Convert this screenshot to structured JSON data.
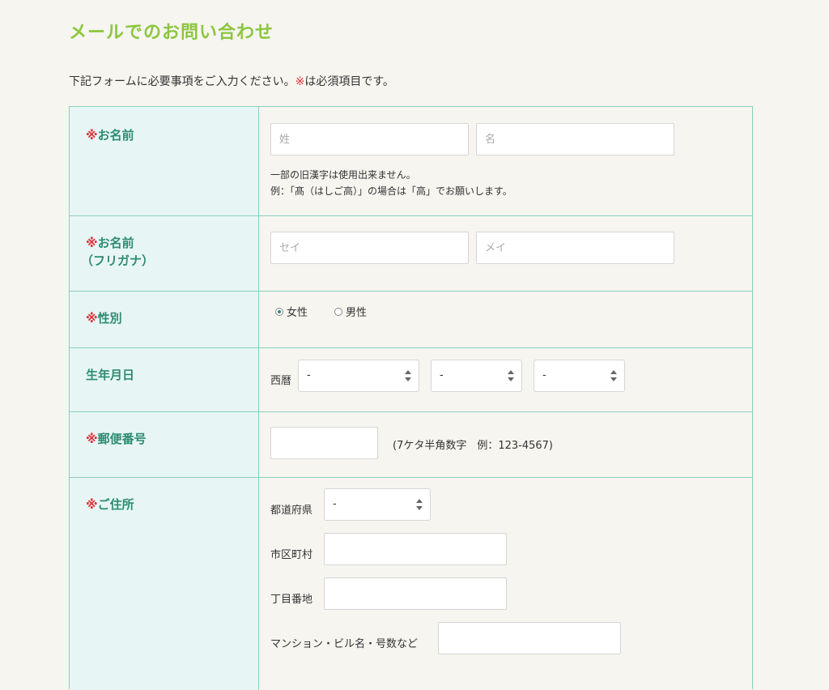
{
  "title": "メールでのお問い合わせ",
  "intro": {
    "text": "下記フォームに必要事項をご入力ください。",
    "mark": "※",
    "text2": "は必須項目です。"
  },
  "required_mark": "※",
  "name": {
    "label": "お名前",
    "last_placeholder": "姓",
    "first_placeholder": "名",
    "note1": "一部の旧漢字は使用出来ません。",
    "note2": "例：「髙（はしご高）」の場合は「高」でお願いします。"
  },
  "kana": {
    "label": "お名前",
    "label2": "（フリガナ）",
    "last_placeholder": "セイ",
    "first_placeholder": "メイ"
  },
  "gender": {
    "label": "性別",
    "options": [
      "女性",
      "男性"
    ],
    "selected": "女性"
  },
  "birthday": {
    "label": "生年月日",
    "era_label": "西暦",
    "year": "-",
    "month": "-",
    "day": "-"
  },
  "postal": {
    "label": "郵便番号",
    "hint": "(7ケタ半角数字　例：123-4567)"
  },
  "address": {
    "label": "ご住所",
    "prefecture_label": "都道府県",
    "prefecture_value": "-",
    "city_label": "市区町村",
    "block_label": "丁目番地",
    "building_label": "マンション・ビル名・号数など"
  },
  "colors": {
    "accent": "#8cc63f",
    "label_text": "#2e8c73",
    "required": "#e0303a",
    "border": "#8ccfbe",
    "label_bg": "#e7f6f4"
  }
}
